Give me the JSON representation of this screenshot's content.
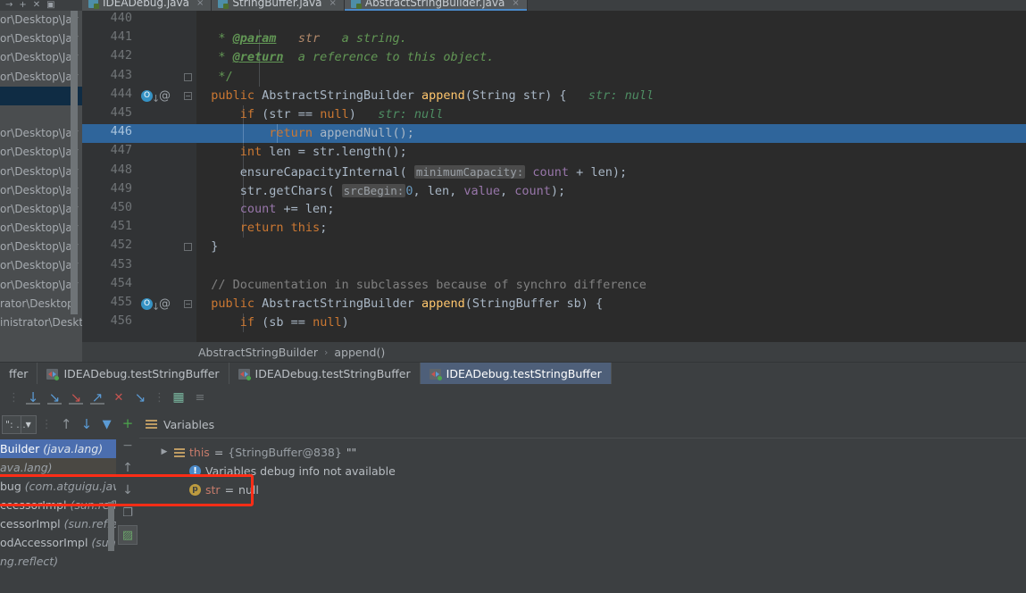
{
  "window": {
    "theme_bg": "#3c3f41",
    "editor_bg": "#2b2b2b",
    "accent": "#4b6eaf",
    "highlight_line_color": "#2f659b",
    "annotation_color": "#ff2d16"
  },
  "toolbar": {
    "glyphs": [
      "→",
      "+",
      "✕",
      "▣",
      "▦"
    ]
  },
  "editor_tabs": [
    {
      "label": "IDEADebug.java",
      "close": "×",
      "active": false
    },
    {
      "label": "StringBuffer.java",
      "close": "×",
      "active": false
    },
    {
      "label": "AbstractStringBuilder.java",
      "close": "×",
      "active": true
    }
  ],
  "background_paths": {
    "rows": [
      "or\\Desktop\\Jav",
      "or\\Desktop\\Jav",
      "or\\Desktop\\Jav",
      "or\\Desktop\\Jav",
      "",
      "",
      "or\\Desktop\\Jav",
      "or\\Desktop\\Jav",
      "or\\Desktop\\Jav",
      "or\\Desktop\\Jav",
      "or\\Desktop\\Jav",
      "or\\Desktop\\Jav",
      "or\\Desktop\\Jav",
      "or\\Desktop\\Jav",
      "or\\Desktop\\Jav",
      "rator\\Desktop\\",
      "inistrator\\Deskt"
    ],
    "selected_index": 4
  },
  "code": {
    "first_visible_line": 440,
    "highlighted_line": 446,
    "lines": [
      {
        "num": "440",
        "text": ""
      },
      {
        "num": "441",
        "text": "     * @param   str   a string."
      },
      {
        "num": "442",
        "text": "     * @return  a reference to this object."
      },
      {
        "num": "443",
        "text": "     */"
      },
      {
        "num": "444",
        "text": "    public AbstractStringBuilder append(String str) {   str: null"
      },
      {
        "num": "445",
        "text": "        if (str == null)   str: null"
      },
      {
        "num": "446",
        "text": "            return appendNull();"
      },
      {
        "num": "447",
        "text": "        int len = str.length();"
      },
      {
        "num": "448",
        "text": "        ensureCapacityInternal( minimumCapacity: count + len);"
      },
      {
        "num": "449",
        "text": "        str.getChars( srcBegin: 0, len, value, count);"
      },
      {
        "num": "450",
        "text": "        count += len;"
      },
      {
        "num": "451",
        "text": "        return this;"
      },
      {
        "num": "452",
        "text": "    }"
      },
      {
        "num": "453",
        "text": ""
      },
      {
        "num": "454",
        "text": "    // Documentation in subclasses because of synchro difference"
      },
      {
        "num": "455",
        "text": "    public AbstractStringBuilder append(StringBuffer sb) {"
      },
      {
        "num": "456",
        "text": "        if (sb == null)"
      }
    ],
    "gutter_icons": {
      "override_marker": "O",
      "override_arrow": "↓",
      "annotation_marker": "@",
      "fold_collapse": "−"
    },
    "inline_hints": [
      {
        "line": "444",
        "text": "str: null"
      },
      {
        "line": "445",
        "text": "str: null"
      }
    ],
    "param_chips": [
      {
        "line": "448",
        "text": "minimumCapacity:"
      },
      {
        "line": "449",
        "text": "srcBegin:"
      }
    ]
  },
  "breadcrumb": {
    "items": [
      "AbstractStringBuilder",
      "append()"
    ],
    "separator": "›"
  },
  "debug_tabs": [
    {
      "label": "ffer",
      "active": false,
      "partial": true
    },
    {
      "label": "IDEADebug.testStringBuffer",
      "active": false
    },
    {
      "label": "IDEADebug.testStringBuffer",
      "active": false
    },
    {
      "label": "IDEADebug.testStringBuffer",
      "active": true
    }
  ],
  "stepper_toolbar": {
    "buttons": [
      {
        "name": "show-execution-point",
        "glyph": "↓",
        "color": "#5b9bd5"
      },
      {
        "name": "step-over",
        "glyph": "↘",
        "color": "#5b9bd5"
      },
      {
        "name": "step-into",
        "glyph": "↘",
        "color": "#c75450"
      },
      {
        "name": "step-out",
        "glyph": "↗",
        "color": "#5b9bd5"
      },
      {
        "name": "force-step-into",
        "glyph": "✕",
        "color": "#c75450"
      },
      {
        "name": "run-to-cursor",
        "glyph": "↘",
        "color": "#5b9bd5"
      },
      {
        "name": "evaluate-expression",
        "glyph": "▦",
        "color": "#7ab8a0"
      },
      {
        "name": "mute-breakpoints",
        "glyph": "≡",
        "color": "#6e7376"
      }
    ]
  },
  "frames": {
    "thread_selector": {
      "label": "\": ...",
      "caret": "▼"
    },
    "toolbar": [
      {
        "name": "frames-up",
        "glyph": "↑",
        "color": "#8d9398"
      },
      {
        "name": "frames-down",
        "glyph": "↓",
        "color": "#5b9bd5"
      },
      {
        "name": "frames-filter",
        "glyph": "▼",
        "color": "#5b9bd5"
      }
    ],
    "rows": [
      {
        "text": "Builder",
        "pkg": "(java.lang)",
        "selected": true
      },
      {
        "text": "",
        "pkg": "ava.lang)",
        "selected": false,
        "dim": true
      },
      {
        "text": "bug",
        "pkg": "(com.atguigu.java",
        "selected": false
      },
      {
        "text": "ccessorImpl",
        "pkg": "(sun.reflec",
        "selected": false
      },
      {
        "text": "cessorImpl",
        "pkg": "(sun.reflec",
        "selected": false
      },
      {
        "text": "odAccessorImpl",
        "pkg": "(sun.r",
        "selected": false
      },
      {
        "text": "",
        "pkg": "ng.reflect)",
        "selected": false
      }
    ]
  },
  "watch_toolbar": {
    "buttons": [
      {
        "name": "add-watch",
        "glyph": "+",
        "color": "#4ca64c",
        "selected": false
      },
      {
        "name": "remove-watch",
        "glyph": "−",
        "color": "#7b8084",
        "selected": false
      },
      {
        "name": "move-watch-up",
        "glyph": "↑",
        "color": "#8d9398",
        "selected": false
      },
      {
        "name": "move-watch-down",
        "glyph": "↓",
        "color": "#8d9398",
        "selected": false
      },
      {
        "name": "copy-value",
        "glyph": "❐",
        "color": "#8d9398",
        "selected": false
      },
      {
        "name": "toggle-watches-in-variables",
        "glyph": "▨",
        "color": "#6ba46b",
        "selected": true
      }
    ]
  },
  "variables": {
    "title": "Variables",
    "rows": [
      {
        "icon": "object-icon",
        "twisty": "▶",
        "name": "this",
        "eq": "=",
        "value": "{StringBuffer@838}",
        "extra": "\"\"",
        "type": "object"
      },
      {
        "icon": "info-icon",
        "twisty": "",
        "name": "",
        "eq": "",
        "value": "Variables debug info not available",
        "extra": "",
        "type": "warning"
      },
      {
        "icon": "parameter-icon",
        "twisty": "",
        "name": "str",
        "eq": "=",
        "value": "null",
        "extra": "",
        "type": "parameter",
        "annotated": true
      }
    ],
    "icon_letters": {
      "info": "!",
      "parameter": "p"
    }
  }
}
